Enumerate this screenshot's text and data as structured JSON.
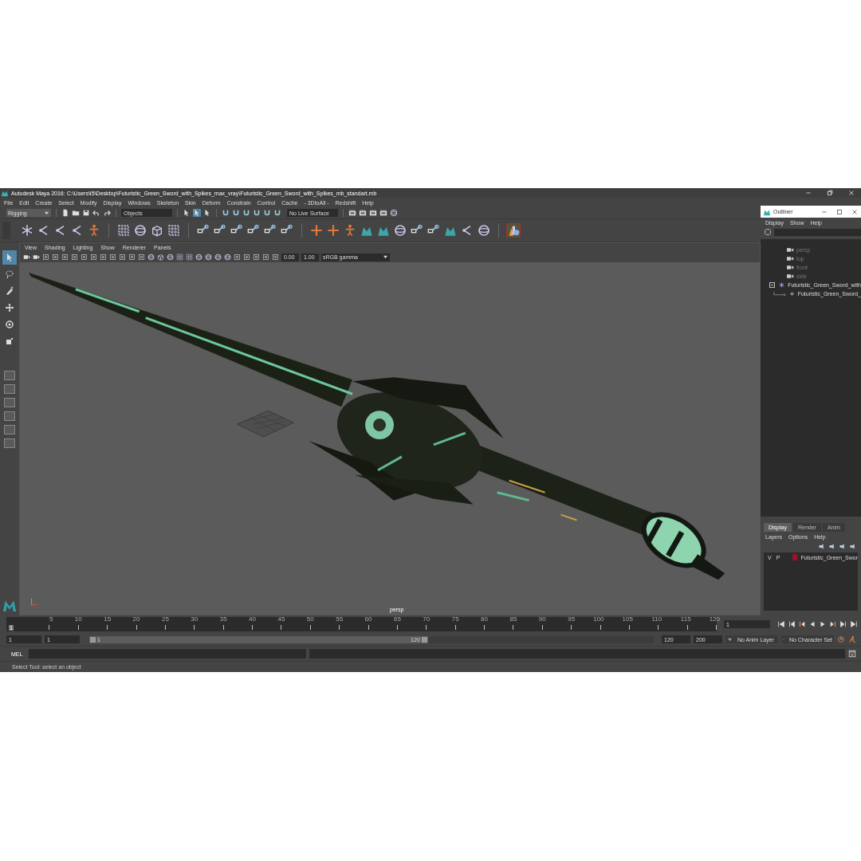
{
  "window": {
    "title": "Autodesk Maya 2016: C:\\Users\\I5\\Desktop\\Futuristic_Green_Sword_with_Spikes_max_vray\\Futuristic_Green_Sword_with_Spikes_mb_standart.mb"
  },
  "menu_bar": [
    "File",
    "Edit",
    "Create",
    "Select",
    "Modify",
    "Display",
    "Windows",
    "Skeleton",
    "Skin",
    "Deform",
    "Constrain",
    "Control",
    "Cache",
    "- 3DtoAll -",
    "Redshift",
    "Help"
  ],
  "status_line": {
    "mode": "Rigging",
    "selection_mask": "Objects",
    "live_surface": "No Live Surface"
  },
  "toolbox": [
    {
      "selected": true
    },
    {
      "selected": false
    },
    {
      "selected": false
    },
    {
      "selected": false
    },
    {
      "selected": false
    },
    {
      "selected": false
    }
  ],
  "viewport": {
    "menu": [
      "View",
      "Shading",
      "Lighting",
      "Show",
      "Renderer",
      "Panels"
    ],
    "exposure": "0.00",
    "gamma": "1.00",
    "color_space": "sRGB gamma",
    "camera_label": "persp"
  },
  "outliner": {
    "title": "Outliner",
    "menu": [
      "Display",
      "Show",
      "Help"
    ],
    "items": [
      {
        "label": "persp",
        "kind": "camera"
      },
      {
        "label": "top",
        "kind": "camera"
      },
      {
        "label": "front",
        "kind": "camera"
      },
      {
        "label": "side",
        "kind": "camera"
      },
      {
        "label": "Futuristic_Green_Sword_with",
        "kind": "group",
        "expanded": true,
        "children": [
          {
            "label": "Futuristic_Green_Sword_",
            "kind": "mesh"
          }
        ]
      }
    ]
  },
  "layer_editor": {
    "tabs": [
      {
        "label": "Display",
        "selected": true
      },
      {
        "label": "Render",
        "selected": false
      },
      {
        "label": "Anim",
        "selected": false
      }
    ],
    "menu": [
      "Layers",
      "Options",
      "Help"
    ],
    "layers": [
      {
        "visible": "V",
        "playback": "P",
        "color": "#a0102c",
        "name": "Futuristic_Green_Swor"
      }
    ]
  },
  "time_slider": {
    "current_frame": "1",
    "level": 0,
    "ticks": [
      "5",
      "10",
      "15",
      "20",
      "25",
      "30",
      "35",
      "40",
      "45",
      "50",
      "55",
      "60",
      "65",
      "70",
      "75",
      "80",
      "85",
      "90",
      "95",
      "100",
      "105",
      "110",
      "115",
      "120"
    ],
    "current_frame_field": "1"
  },
  "range_slider": {
    "level": 0.6,
    "start": "1",
    "playback_start": "1",
    "range_start": "1",
    "range_end": "120",
    "playback_end": "120",
    "end": "200",
    "anim_layer": "No Anim Layer",
    "character_set": "No Character Set"
  },
  "command_line": {
    "language": "MEL"
  },
  "help_line": "Select Tool: select an object"
}
